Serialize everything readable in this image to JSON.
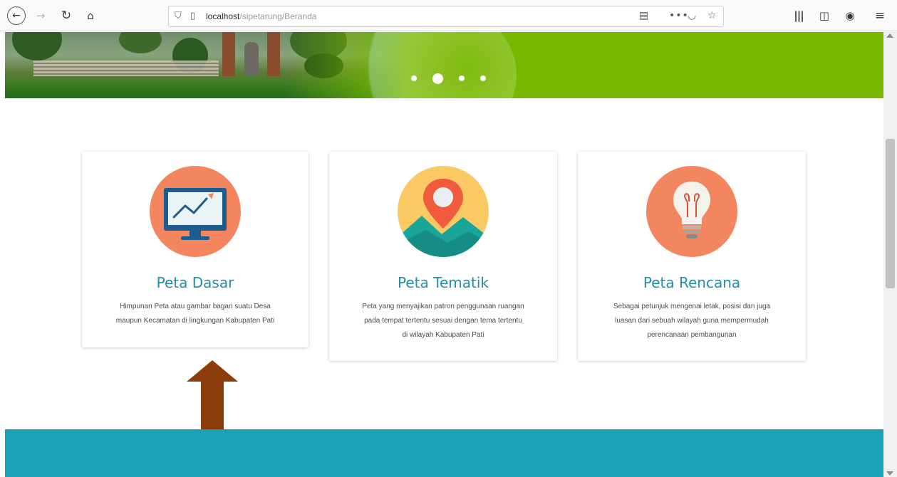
{
  "browser": {
    "url_host": "localhost",
    "url_path": "/sipetarung/Beranda",
    "icons": {
      "back": "arrow-left-icon",
      "forward": "arrow-right-icon",
      "reload": "reload-icon",
      "home": "home-icon",
      "shield": "shield-icon",
      "page": "page-icon",
      "reader": "reader-view-icon",
      "more": "more-icon",
      "pocket": "pocket-icon",
      "bookmark": "star-icon",
      "library": "library-icon",
      "sidebar": "sidebar-icon",
      "account": "account-icon",
      "menu": "hamburger-menu-icon"
    }
  },
  "hero": {
    "slide_count": 4,
    "active_slide": 2,
    "color": "#78b800"
  },
  "cards": [
    {
      "title": "Peta Dasar",
      "desc_lines": [
        "Himpunan Peta atau gambar bagan suatu Desa",
        "maupun Kecamatan di lingkungan Kabupaten Pati"
      ],
      "icon": "monitor-chart-icon"
    },
    {
      "title": "Peta Tematik",
      "desc_lines": [
        "Peta yang menyajikan patron penggunaan ruangan",
        "pada tempat tertentu sesuai dengan tema tertentu",
        "di wilayah Kabupaten Pati"
      ],
      "icon": "map-pin-icon"
    },
    {
      "title": "Peta Rencana",
      "desc_lines": [
        "Sebagai petunjuk mengenai letak, posisi dan juga",
        "luasan dari sebuah wilayah guna mempermudah",
        "perencanaan pembangunan"
      ],
      "icon": "light-bulb-icon"
    }
  ],
  "colors": {
    "accent_title": "#1f8fa6",
    "footer": "#1ba1b4",
    "annotation_arrow": "#8b3e0a",
    "icon_orange": "#f4865f",
    "icon_yellow": "#fbc964"
  }
}
